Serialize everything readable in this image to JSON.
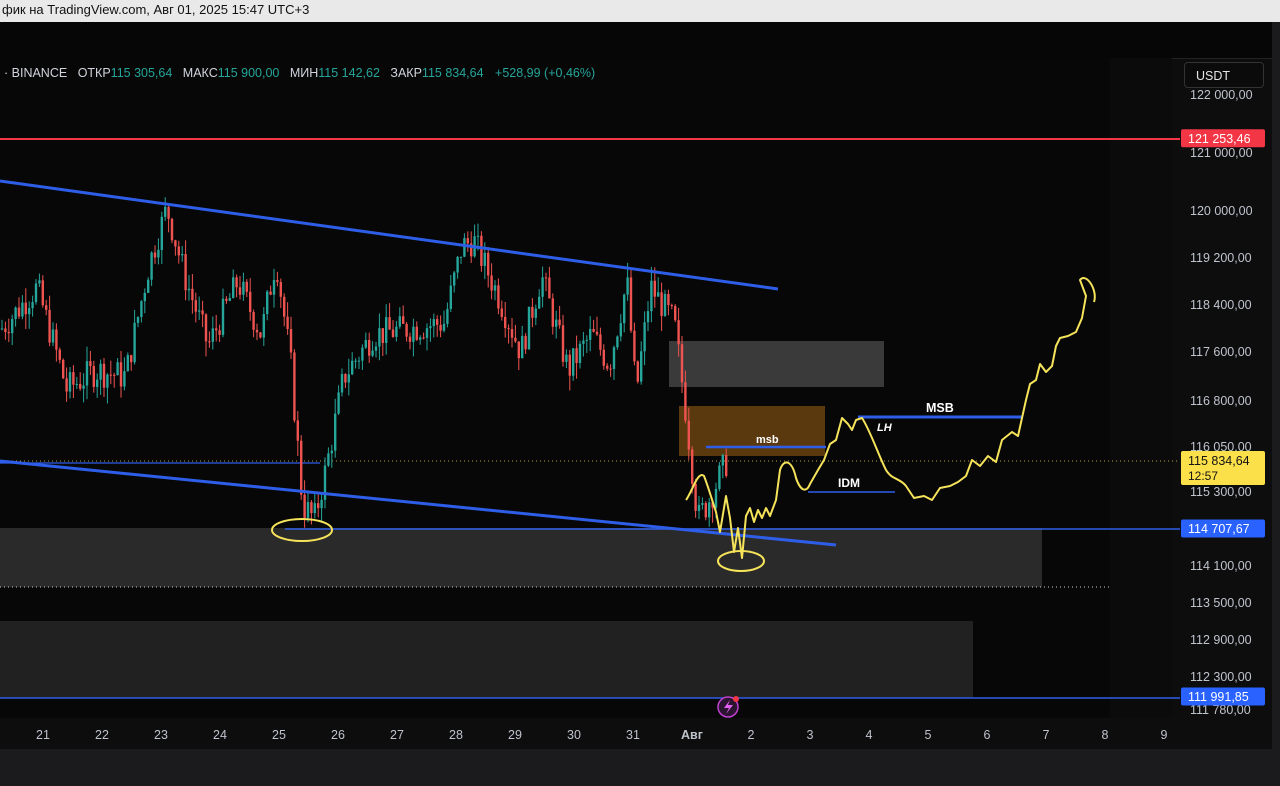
{
  "window": {
    "title": "фик на TradingView.com, Авг 01, 2025 15:47 UTC+3"
  },
  "legend": {
    "symbol": "· BINANCE",
    "open_label": "ОТКР",
    "open": "115 305,64",
    "high_label": "МАКС",
    "high": "115 900,00",
    "low_label": "МИН",
    "low": "115 142,62",
    "close_label": "ЗАКР",
    "close": "115 834,64",
    "change": "+528,99 (+0,46%)"
  },
  "currency": "USDT",
  "colors": {
    "up": "#26a69a",
    "down": "#ef5350",
    "trend": "#2e5ee8",
    "resistance": "#f23645",
    "drawing": "#f5e35a",
    "current_price": "#fbe04a"
  },
  "price_tags": [
    {
      "label": "121 253,46",
      "value": 121253.46,
      "color": "#f23645",
      "text_color": "#ffffff"
    },
    {
      "label": "114 707,67",
      "value": 114707.67,
      "color": "#2962ff",
      "text_color": "#ffffff"
    },
    {
      "label": "111 991,85",
      "value": 111991.85,
      "color": "#2962ff",
      "text_color": "#ffffff"
    }
  ],
  "current_price": {
    "label": "115 834,64",
    "countdown": "12:57",
    "value": 115834.64
  },
  "annotations": {
    "msb_small": "msb",
    "msb": "MSB",
    "lh": "LH",
    "idm": "IDM"
  },
  "chart_data": {
    "type": "candlestick",
    "y_axis_labels": [
      "122 000,00",
      "121 000,00",
      "120 000,00",
      "119 200,00",
      "118 400,00",
      "117 600,00",
      "116 800,00",
      "116 050,00",
      "115 300,00",
      "114 100,00",
      "113 500,00",
      "112 900,00",
      "112 300,00",
      "111 780,00"
    ],
    "y_axis_values": [
      122000,
      121000,
      120000,
      119200,
      118400,
      117600,
      116800,
      116050,
      115300,
      114100,
      113500,
      112900,
      112300,
      111780
    ],
    "x_axis_labels": [
      "21",
      "22",
      "23",
      "24",
      "25",
      "26",
      "27",
      "28",
      "29",
      "30",
      "31",
      "Авг",
      "2",
      "3",
      "4",
      "5",
      "6",
      "7",
      "8",
      "9"
    ],
    "price_path": [
      {
        "day": 20.3,
        "price": 118000
      },
      {
        "day": 20.9,
        "price": 118700
      },
      {
        "day": 21.4,
        "price": 117000
      },
      {
        "day": 21.9,
        "price": 117300
      },
      {
        "day": 22.4,
        "price": 117200
      },
      {
        "day": 22.8,
        "price": 119100
      },
      {
        "day": 23.1,
        "price": 120050
      },
      {
        "day": 23.4,
        "price": 118900
      },
      {
        "day": 23.8,
        "price": 117700
      },
      {
        "day": 24.3,
        "price": 118800
      },
      {
        "day": 24.7,
        "price": 117900
      },
      {
        "day": 24.95,
        "price": 119200
      },
      {
        "day": 25.2,
        "price": 117400
      },
      {
        "day": 25.4,
        "price": 115100
      },
      {
        "day": 25.6,
        "price": 114850
      },
      {
        "day": 25.8,
        "price": 115700
      },
      {
        "day": 26.1,
        "price": 117200
      },
      {
        "day": 26.6,
        "price": 117900
      },
      {
        "day": 27.2,
        "price": 118000
      },
      {
        "day": 27.8,
        "price": 118100
      },
      {
        "day": 28.1,
        "price": 119400
      },
      {
        "day": 28.3,
        "price": 119500
      },
      {
        "day": 28.7,
        "price": 118600
      },
      {
        "day": 29.1,
        "price": 117600
      },
      {
        "day": 29.45,
        "price": 118900
      },
      {
        "day": 29.9,
        "price": 117300
      },
      {
        "day": 30.3,
        "price": 117900
      },
      {
        "day": 30.6,
        "price": 117400
      },
      {
        "day": 30.9,
        "price": 118800
      },
      {
        "day": 31.05,
        "price": 116900
      },
      {
        "day": 31.3,
        "price": 118700
      },
      {
        "day": 31.7,
        "price": 118100
      },
      {
        "day": 31.9,
        "price": 116600
      },
      {
        "day": 32.1,
        "price": 114850
      },
      {
        "day": 32.3,
        "price": 115200
      },
      {
        "day": 32.6,
        "price": 115834.64
      }
    ]
  }
}
